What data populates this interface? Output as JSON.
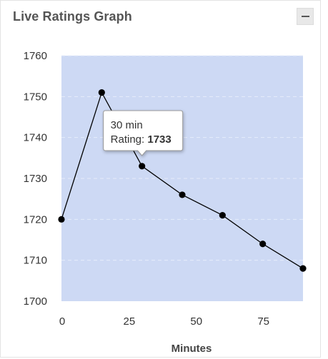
{
  "widget": {
    "title": "Live Ratings Graph",
    "collapse_icon": "minus-icon"
  },
  "chart_data": {
    "type": "line",
    "x": [
      0,
      15,
      30,
      45,
      60,
      75,
      90
    ],
    "y": [
      1720,
      1751,
      1733,
      1726,
      1721,
      1714,
      1708
    ],
    "xlabel": "Minutes",
    "ylabel": "",
    "xlim": [
      0,
      90
    ],
    "ylim": [
      1700,
      1760
    ],
    "x_ticks": [
      "0",
      "25",
      "50",
      "75"
    ],
    "y_ticks": [
      "1700",
      "1710",
      "1720",
      "1730",
      "1740",
      "1750",
      "1760"
    ],
    "grid": true,
    "colors": {
      "plot_bg": "#cdd9f4",
      "line": "#000000",
      "grid": "#e6ecfa"
    },
    "tooltip": {
      "title": "30 min",
      "label": "Rating: ",
      "value": "1733"
    }
  }
}
